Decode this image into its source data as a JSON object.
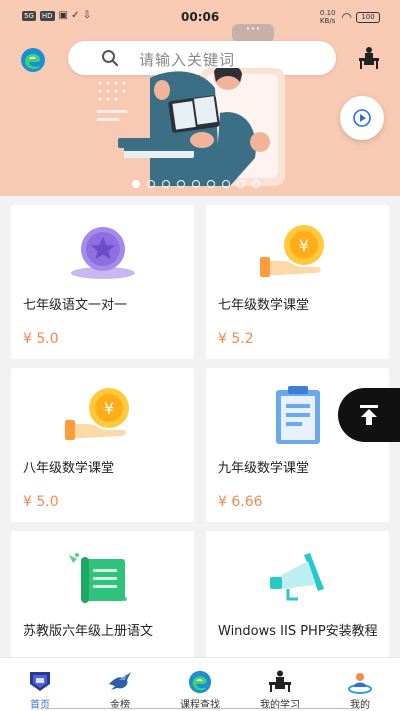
{
  "status": {
    "time": "00:06",
    "left_chips": [
      "5G",
      "HD"
    ],
    "speed": "0.10",
    "speed_unit": "KB/s",
    "battery": "100"
  },
  "header": {
    "search_placeholder": "请输入关键词"
  },
  "banner": {
    "page_count": 9,
    "active_page": 0
  },
  "courses": [
    {
      "title": "七年级语文一对一",
      "price": "¥ 5.0",
      "icon": "medal-star-icon"
    },
    {
      "title": "七年级数学课堂",
      "price": "¥ 5.2",
      "icon": "coin-hand-icon"
    },
    {
      "title": "八年级数学课堂",
      "price": "¥ 5.0",
      "icon": "coin-hand-icon"
    },
    {
      "title": "九年级数学课堂",
      "price": "¥ 6.66",
      "icon": "clipboard-icon"
    },
    {
      "title": "苏教版六年级上册语文",
      "price": "",
      "icon": "scroll-icon"
    },
    {
      "title": "Windows IIS PHP安装教程",
      "price": "",
      "icon": "megaphone-icon"
    }
  ],
  "nav": {
    "items": [
      {
        "label": "首页",
        "icon": "home-badge-icon"
      },
      {
        "label": "金榜",
        "icon": "bird-icon"
      },
      {
        "label": "课程查找",
        "icon": "edge-icon"
      },
      {
        "label": "我的学习",
        "icon": "desk-icon"
      },
      {
        "label": "我的",
        "icon": "profile-icon"
      }
    ]
  },
  "colors": {
    "banner_bg": "#f8c9b3",
    "price": "#f5894a",
    "active_nav": "#2b6fe0"
  }
}
